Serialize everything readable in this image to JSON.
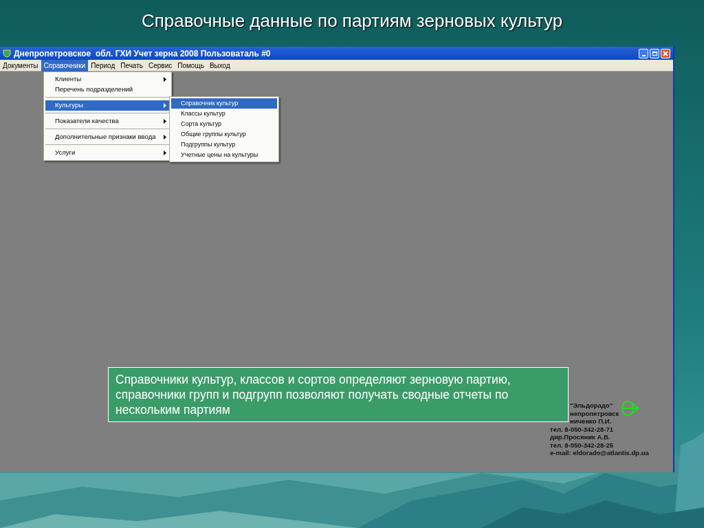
{
  "slide_title": "Справочные данные по партиям зерновых культур",
  "window": {
    "title": "Днепропетровское  обл. ГХИ Учет зерна 2008 Пользоваталь #0"
  },
  "menu_bar": [
    {
      "label": "Документы",
      "selected": false
    },
    {
      "label": "Справочники",
      "selected": true
    },
    {
      "label": "Период",
      "selected": false
    },
    {
      "label": "Печать",
      "selected": false
    },
    {
      "label": "Сервис",
      "selected": false
    },
    {
      "label": "Помощь",
      "selected": false
    },
    {
      "label": "Выход",
      "selected": false
    }
  ],
  "dropdown": [
    {
      "label": "Клиенты",
      "has_submenu": true,
      "selected": false,
      "separator_after": false
    },
    {
      "label": "Перечень подразделений",
      "has_submenu": false,
      "selected": false,
      "separator_after": true
    },
    {
      "label": "Культуры",
      "has_submenu": true,
      "selected": true,
      "separator_after": true
    },
    {
      "label": "Показатели качества",
      "has_submenu": true,
      "selected": false,
      "separator_after": true
    },
    {
      "label": "Дополнительные признаки ввода",
      "has_submenu": true,
      "selected": false,
      "separator_after": true
    },
    {
      "label": "Услуги",
      "has_submenu": true,
      "selected": false,
      "separator_after": false
    }
  ],
  "submenu": [
    {
      "label": "Справочник культур",
      "selected": true
    },
    {
      "label": "Классы культур",
      "selected": false
    },
    {
      "label": "Сорта культур",
      "selected": false
    },
    {
      "label": "Общие группы культур",
      "selected": false
    },
    {
      "label": "Подгруппы культур",
      "selected": false
    },
    {
      "label": "Учетные цены на культуры",
      "selected": false
    }
  ],
  "contact_lines": [
    "\"Эльдорадо\"",
    "непропетровск",
    "ниченко П.И.",
    "тел. 8-050-342-28-71",
    "дир.Просяник А.В.",
    "тел. 8-050-342-28-25",
    "e-mail: eldorado@atlantis.dp.ua"
  ],
  "callout": "Справочники культур, классов и сортов определяют зерновую партию, справочники групп и подгрупп позволяют получать сводные отчеты по нескольким партиям"
}
